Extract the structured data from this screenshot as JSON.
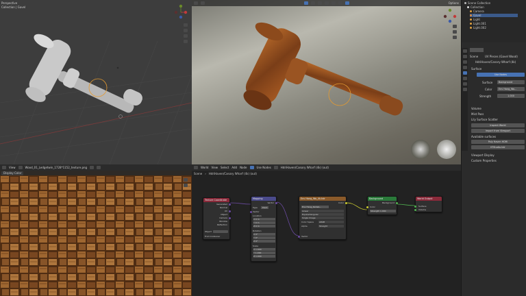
{
  "viewport_left": {
    "title_line1": "Perspective",
    "title_line2": "Collection | Gavel"
  },
  "viewport_render": {
    "options_label": "Options"
  },
  "outliner": {
    "root": "Scene Collection",
    "items": [
      {
        "label": "Collection",
        "color": "#dddddd"
      },
      {
        "label": "Camera",
        "color": "#e0a040"
      },
      {
        "label": "Gavel",
        "color": "#e08a3a"
      },
      {
        "label": "Light",
        "color": "#e0a040"
      },
      {
        "label": "Light.001",
        "color": "#e0a040"
      },
      {
        "label": "Light.002",
        "color": "#e0a040"
      }
    ]
  },
  "properties": {
    "scene_label": "Scene",
    "world_name": "UV Pieces (Gavel Wood)",
    "world_short": "HdriHaven/Canary Wharf (4k)",
    "surface_label": "Surface",
    "use_nodes": "Use Nodes",
    "surface_field_label": "Surface",
    "surface_value": "Background",
    "color_label": "Color",
    "color_value": "Env Hang_Wo...",
    "strength_label": "Strength",
    "strength_value": "1.000",
    "volume": "Volume",
    "mist_pass": "Mist Pass",
    "lily_surface_scatter": "Lily Surface Scatter",
    "inspect_world": "Inspect World",
    "import_from_viewport": "Import from Viewport",
    "available_surfaces": "Available surfaces",
    "poly_haven_hdri": "Poly Haven HDRI",
    "ktsstudio": "KTStudio.hdr",
    "viewport_display": "Viewport Display",
    "custom_properties": "Custom Properties"
  },
  "image_editor": {
    "view_label": "View",
    "image_name": "Wood_01_Ledgetwin_1728*1152_texture.png",
    "filter_label": "Display Color"
  },
  "node_editor": {
    "world_label": "World",
    "menus": [
      "View",
      "Select",
      "Add",
      "Node"
    ],
    "use_nodes": "Use Nodes",
    "datablock": "HdriHaven/Canary Wharf (4k) (out)",
    "breadcrumb": "HdriHaven/Canary Wharf (4k) (out)",
    "world_breadcrumb_root": "Scene"
  },
  "nodes": {
    "texcoord": {
      "title": "Texture Coordinate",
      "outputs": [
        "Generated",
        "Normal",
        "UV",
        "Object",
        "Camera",
        "Window",
        "Reflection"
      ],
      "object_label": "Object",
      "from_instancer": "From Instancer"
    },
    "mapping": {
      "title": "Mapping",
      "out": "Vector",
      "type_label": "Type",
      "type_value": "Point",
      "vector_label": "Vector",
      "location_label": "Location",
      "loc": [
        "X",
        "Y",
        "Z"
      ],
      "loc_vals": [
        "0 m",
        "0 m",
        "0 m"
      ],
      "rotation_label": "Rotation",
      "rot_vals": [
        "0°",
        "0°",
        "0°"
      ],
      "scale_label": "Scale",
      "scale_vals": [
        "1.000",
        "1.000",
        "1.000"
      ]
    },
    "envtex": {
      "title": "Env Hang_Wo_4k.hdr",
      "out": "Color",
      "file": "Env Hang_Rehab...",
      "rows": [
        "Linear",
        "Equirectangular",
        "Single Image"
      ],
      "color_space_label": "Color Space",
      "color_space_value": "sRGB",
      "alpha_label": "Alpha",
      "alpha_value": "Straight",
      "vector_label": "Vector"
    },
    "background": {
      "title": "Background",
      "out": "Background",
      "color_label": "Color",
      "strength_label": "Strength",
      "strength_value": "1.000"
    },
    "output": {
      "title": "World Output",
      "surface": "Surface",
      "volume": "Volume"
    }
  }
}
